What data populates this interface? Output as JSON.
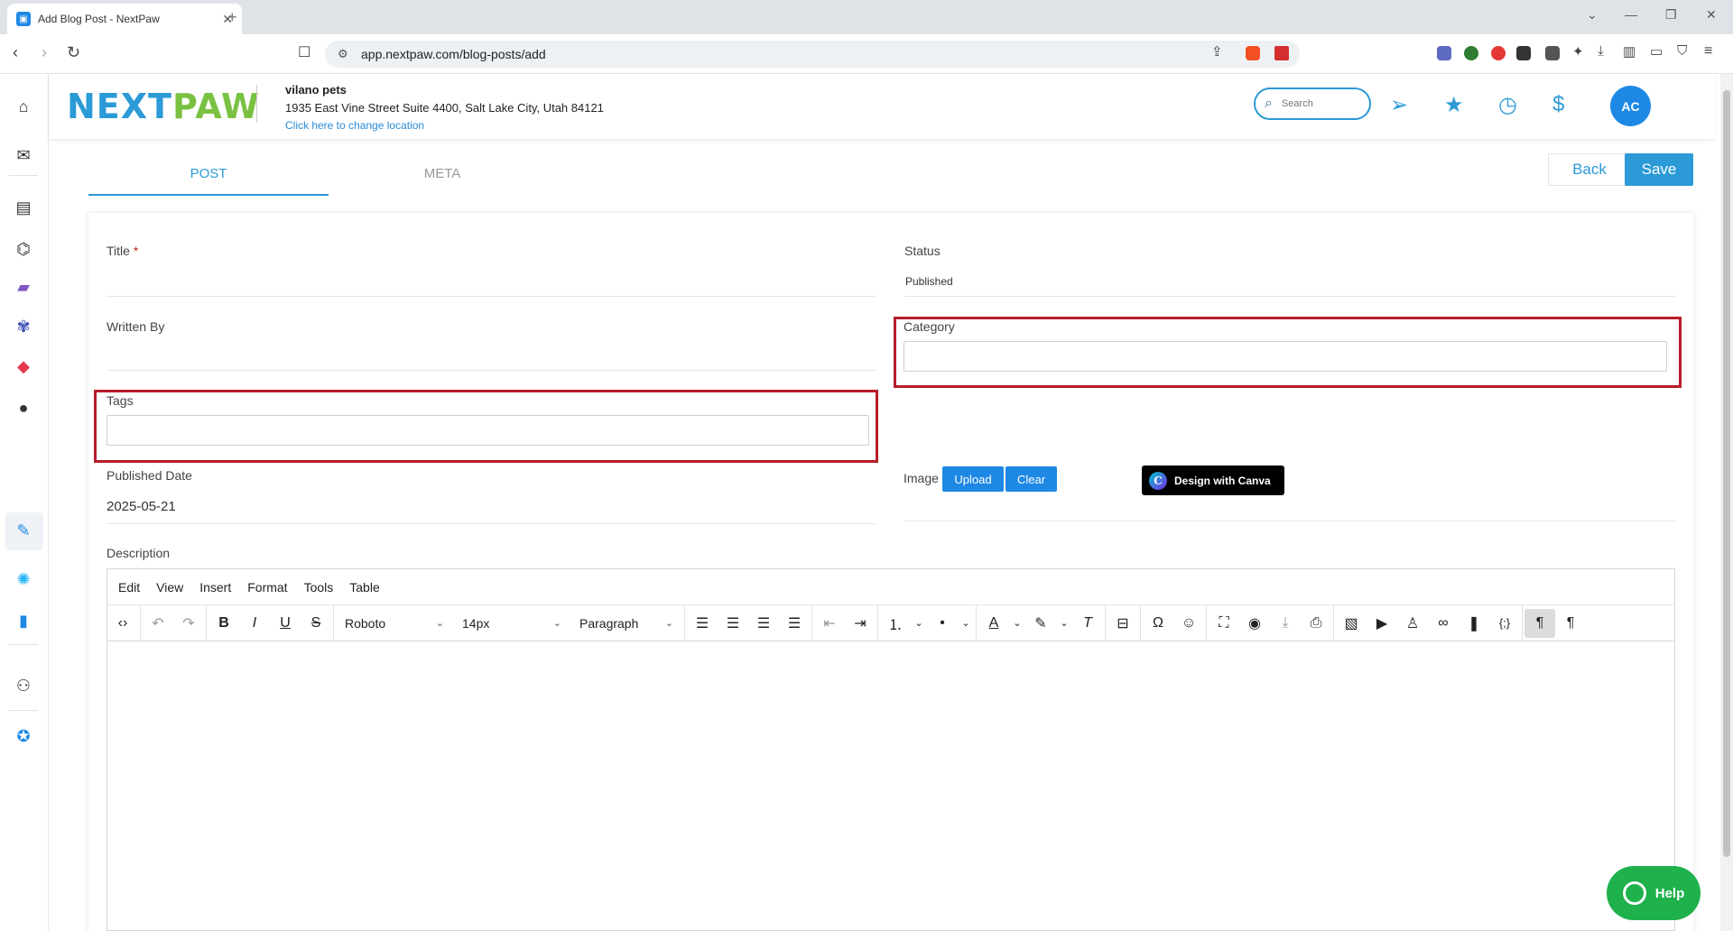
{
  "browser": {
    "tab_title": "Add Blog Post - NextPaw",
    "url": "app.nextpaw.com/blog-posts/add"
  },
  "header": {
    "logo_next": "NEXT",
    "logo_paw": "PAW",
    "location_name": "vilano pets",
    "location_address": "1935 East Vine Street Suite 4400, Salt Lake City, Utah 84121",
    "change_location": "Click here to change location",
    "search_placeholder": "Search",
    "avatar_initials": "AC"
  },
  "tabs": [
    {
      "label": "POST",
      "active": true
    },
    {
      "label": "META",
      "active": false
    }
  ],
  "actions": {
    "back": "Back",
    "save": "Save"
  },
  "form": {
    "title_label": "Title",
    "title_required": "*",
    "status_label": "Status",
    "status_value": "Published",
    "written_by_label": "Written By",
    "category_label": "Category",
    "tags_label": "Tags",
    "published_date_label": "Published Date",
    "published_date_value": "2025-05-21",
    "image_label": "Image",
    "upload": "Upload",
    "clear": "Clear",
    "canva": "Design with Canva",
    "description_label": "Description"
  },
  "editor": {
    "menu": [
      "Edit",
      "View",
      "Insert",
      "Format",
      "Tools",
      "Table"
    ],
    "font": "Roboto",
    "size": "14px",
    "block": "Paragraph"
  },
  "help": "Help",
  "colors": {
    "brand_blue": "#2b9ad6",
    "brand_green": "#7ac142",
    "highlight_red": "#b71c2b",
    "help_green": "#1fb14c"
  }
}
